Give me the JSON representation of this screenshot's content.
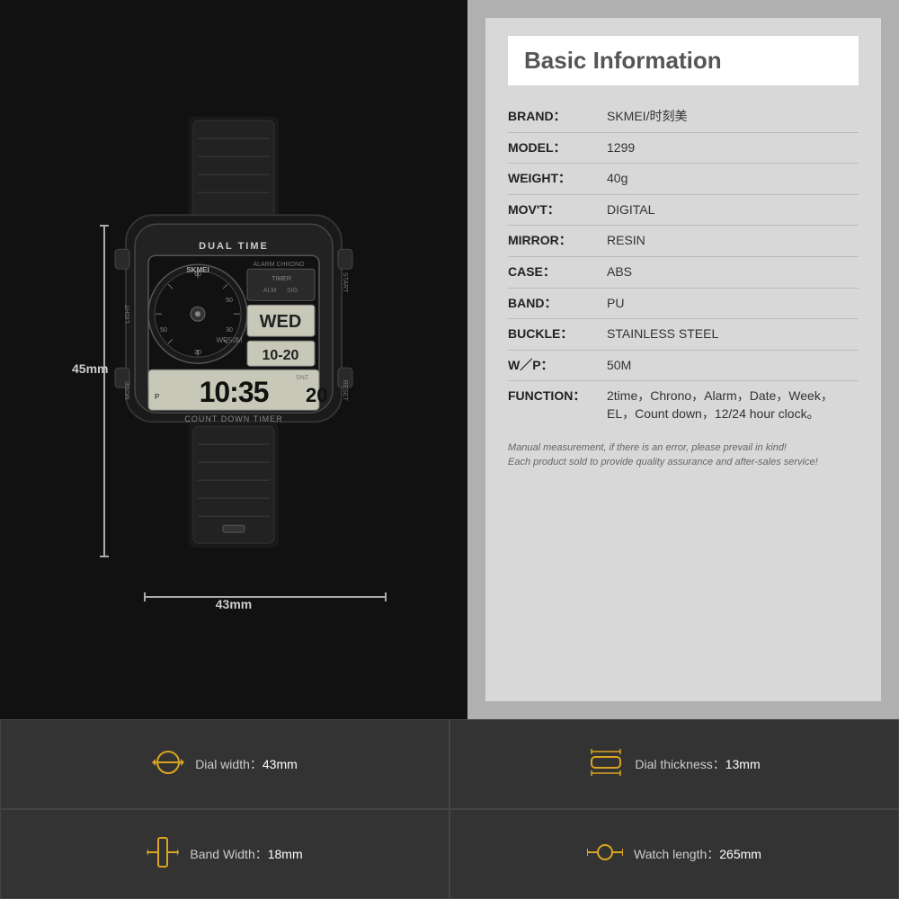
{
  "watch": {
    "dim_height": "45mm",
    "dim_width": "43mm"
  },
  "info": {
    "title": "Basic Information",
    "rows": [
      {
        "label": "BRAND：",
        "value": "SKMEI/时刻美"
      },
      {
        "label": "MODEL：",
        "value": "1299"
      },
      {
        "label": "WEIGHT：",
        "value": "40g"
      },
      {
        "label": "MOV'T：",
        "value": "DIGITAL"
      },
      {
        "label": "MIRROR：",
        "value": "RESIN"
      },
      {
        "label": "CASE：",
        "value": "ABS"
      },
      {
        "label": "BAND：",
        "value": "PU"
      },
      {
        "label": "BUCKLE：",
        "value": "STAINLESS STEEL"
      },
      {
        "label": "W／P：",
        "value": "50M"
      },
      {
        "label": "FUNCTION：",
        "value": "2time，Chrono，Alarm，Date，Week，EL，Count down，12/24 hour clock。"
      }
    ],
    "disclaimer": "Manual measurement, if there is an error, please prevail in kind!\nEach product sold to provide quality assurance and after-sales service!"
  },
  "specs": [
    {
      "icon": "⌚",
      "label": "Dial width：",
      "value": "43mm"
    },
    {
      "icon": "⇔",
      "label": "Dial thickness：",
      "value": "13mm"
    },
    {
      "icon": "▐",
      "label": "Band Width：",
      "value": "18mm"
    },
    {
      "icon": "⟺",
      "label": "Watch length：",
      "value": "265mm"
    }
  ]
}
